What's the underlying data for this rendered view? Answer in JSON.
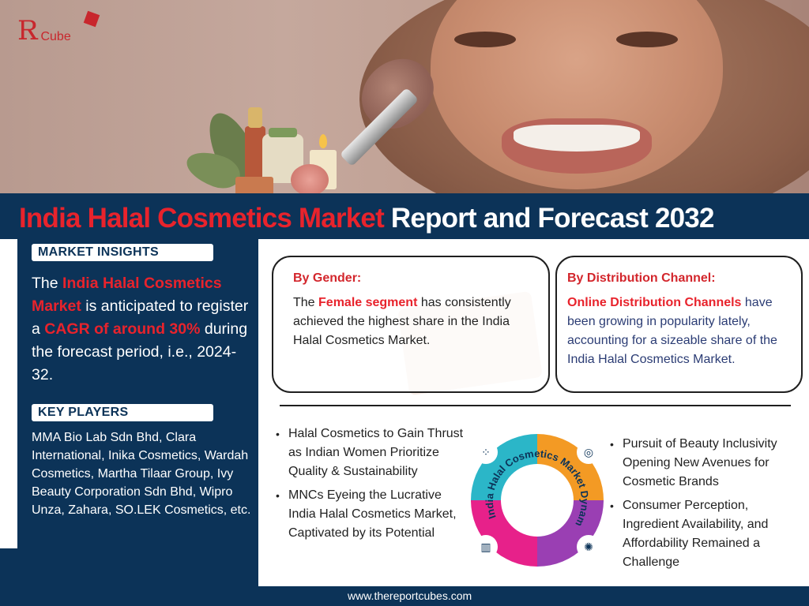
{
  "logo": {
    "mark": "Я",
    "text": "Cube"
  },
  "title": {
    "highlight": "India Halal Cosmetics Market",
    "rest": "Report and Forecast 2032"
  },
  "market_insights": {
    "label": "MARKET INSIGHTS",
    "text_1": "The ",
    "highlight_1": "India Halal Cosmetics Market",
    "text_2": " is anticipated to register a ",
    "highlight_2": "CAGR of around 30%",
    "text_3": " during the forecast period, i.e., 2024-32."
  },
  "key_players": {
    "label": "KEY PLAYERS",
    "text": "MMA Bio Lab Sdn Bhd, Clara International, Inika Cosmetics, Wardah Cosmetics, Martha Tilaar Group, Ivy Beauty Corporation Sdn Bhd, Wipro Unza, Zahara, SO.LEK Cosmetics, etc."
  },
  "by_gender": {
    "heading": "By Gender:",
    "text_1": "The ",
    "highlight": "Female segment",
    "text_2": " has consistently achieved the highest share in the India Halal Cosmetics Market."
  },
  "by_distribution": {
    "heading": "By Distribution Channel:",
    "highlight": "Online Distribution Channels",
    "text": " have been growing in popularity lately, accounting for a sizeable share of the India Halal Cosmetics Market."
  },
  "dynamics": {
    "label": "India Halal Cosmetics Market Dynamics",
    "left_bullets": [
      "Halal Cosmetics to Gain Thrust as Indian Women Prioritize Quality & Sustainability",
      "MNCs Eyeing the Lucrative India Halal Cosmetics Market, Captivated by its Potential"
    ],
    "right_bullets": [
      "Pursuit of Beauty Inclusivity Opening New Avenues for Cosmetic Brands",
      "Consumer Perception, Ingredient Availability, and Affordability Remained a Challenge"
    ],
    "colors": [
      "#2bb6c8",
      "#f39a24",
      "#e7218a",
      "#9a3fb3"
    ],
    "icons": [
      "molecule-icon",
      "target-icon",
      "chart-icon",
      "lightbulb-icon"
    ]
  },
  "footer": {
    "url": "www.thereportcubes.com"
  },
  "colors": {
    "navy": "#0c3358",
    "red": "#e8232c",
    "white": "#ffffff"
  }
}
